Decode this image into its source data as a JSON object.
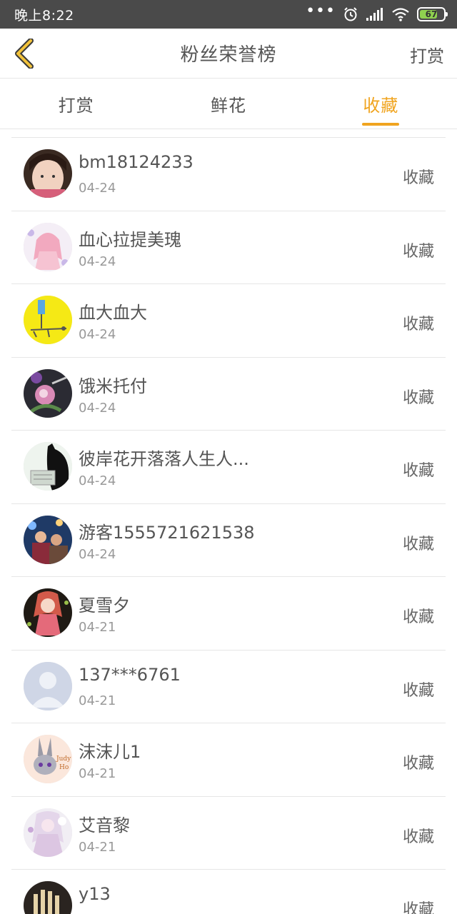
{
  "status_bar": {
    "time": "晚上8:22",
    "battery": "67",
    "icons": [
      "more-dots-icon",
      "alarm-icon",
      "signal-icon",
      "wifi-icon",
      "battery-icon"
    ]
  },
  "header": {
    "title": "粉丝荣誉榜",
    "action_label": "打赏",
    "back_icon": "chevron-left-icon"
  },
  "tabs": [
    {
      "label": "打赏",
      "active": false
    },
    {
      "label": "鲜花",
      "active": false
    },
    {
      "label": "收藏",
      "active": true
    }
  ],
  "colors": {
    "accent": "#f0a41f",
    "status_bar_bg": "#4a4a4a",
    "text": "#555555",
    "subtext": "#999999",
    "divider": "#e6e6e6"
  },
  "fans": [
    {
      "name": "bm18124233",
      "date": "04-24",
      "action": "收藏"
    },
    {
      "name": "血心拉提美瑰",
      "date": "04-24",
      "action": "收藏"
    },
    {
      "name": "血大血大",
      "date": "04-24",
      "action": "收藏"
    },
    {
      "name": "饿米托付",
      "date": "04-24",
      "action": "收藏"
    },
    {
      "name": "彼岸花开落落人生人...",
      "date": "04-24",
      "action": "收藏"
    },
    {
      "name": "游客1555721621538",
      "date": "04-24",
      "action": "收藏"
    },
    {
      "name": "夏雪夕",
      "date": "04-21",
      "action": "收藏"
    },
    {
      "name": "137***6761",
      "date": "04-21",
      "action": "收藏"
    },
    {
      "name": "沫沫儿1",
      "date": "04-21",
      "action": "收藏"
    },
    {
      "name": "艾音黎",
      "date": "04-21",
      "action": "收藏"
    },
    {
      "name": "y13",
      "date": "",
      "action": "收藏"
    }
  ]
}
